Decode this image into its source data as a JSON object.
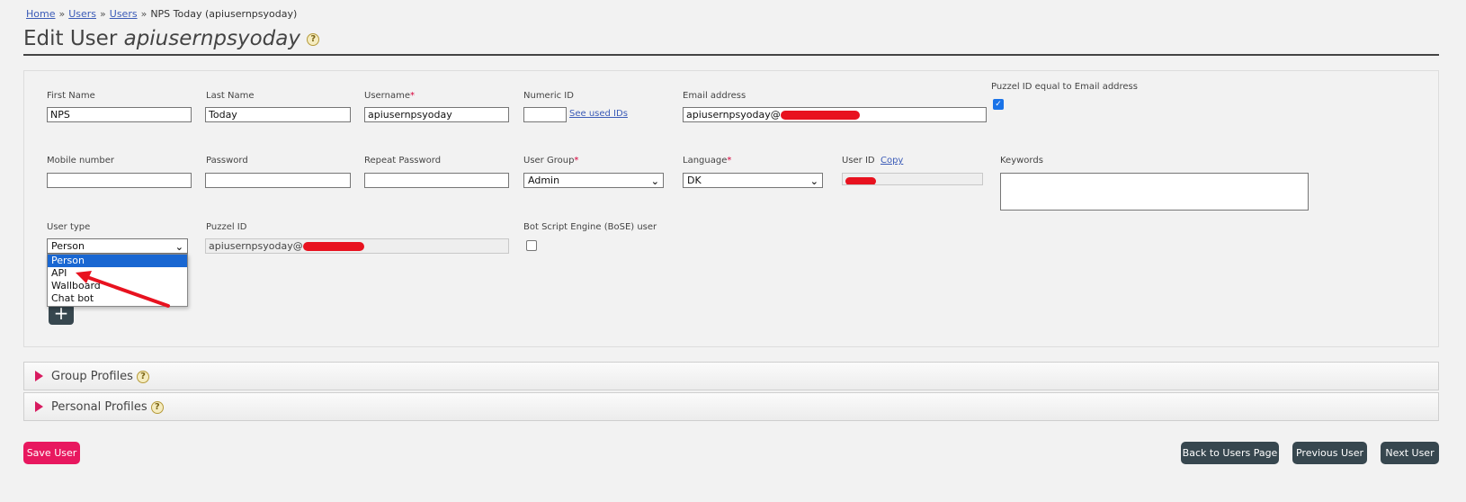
{
  "breadcrumb": {
    "home": "Home",
    "users1": "Users",
    "users2": "Users",
    "current": "NPS Today (apiusernpsyoday)",
    "separator": "»"
  },
  "title": {
    "prefix": "Edit User",
    "username": "apiusernpsyoday",
    "help_icon": "?"
  },
  "form": {
    "first_name": {
      "label": "First Name",
      "value": "NPS"
    },
    "last_name": {
      "label": "Last Name",
      "value": "Today"
    },
    "username": {
      "label": "Username",
      "required": "*",
      "value": "apiusernpsyoday"
    },
    "numeric_id": {
      "label": "Numeric ID",
      "value": "",
      "link": "See used IDs"
    },
    "email": {
      "label": "Email address",
      "value": "apiusernpsyoday@"
    },
    "puzzel_id_equal_email": {
      "label": "Puzzel ID equal to Email address",
      "checked": true
    },
    "mobile": {
      "label": "Mobile number",
      "value": ""
    },
    "password": {
      "label": "Password",
      "value": ""
    },
    "repeat_password": {
      "label": "Repeat Password",
      "value": ""
    },
    "user_group": {
      "label": "User Group",
      "required": "*",
      "value": "Admin"
    },
    "language": {
      "label": "Language",
      "required": "*",
      "value": "DK"
    },
    "user_id": {
      "label": "User ID",
      "copy_link": "Copy"
    },
    "keywords": {
      "label": "Keywords",
      "value": ""
    },
    "user_type": {
      "label": "User type",
      "value": "Person",
      "options": [
        "Person",
        "API",
        "Wallboard",
        "Chat bot"
      ]
    },
    "puzzel_id": {
      "label": "Puzzel ID",
      "value": "apiusernpsyoday@"
    },
    "bose_user": {
      "label": "Bot Script Engine (BoSE) user",
      "checked": false
    },
    "add_button": "+"
  },
  "sections": {
    "group_profiles": "Group Profiles",
    "personal_profiles": "Personal Profiles",
    "help_icon": "?"
  },
  "buttons": {
    "save": "Save User",
    "back": "Back to Users Page",
    "previous": "Previous User",
    "next": "Next User"
  },
  "colors": {
    "accent_pink": "#e8185f",
    "dark_button": "#37474f",
    "redaction": "#e8121f",
    "dropdown_highlight": "#1967d2"
  }
}
